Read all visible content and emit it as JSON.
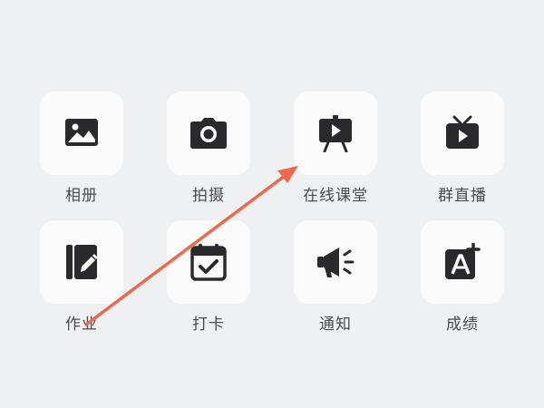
{
  "apps": [
    {
      "label": "相册",
      "icon": "photo-album-icon"
    },
    {
      "label": "拍摄",
      "icon": "camera-icon"
    },
    {
      "label": "在线课堂",
      "icon": "online-class-icon"
    },
    {
      "label": "群直播",
      "icon": "tv-live-icon"
    },
    {
      "label": "作业",
      "icon": "homework-icon"
    },
    {
      "label": "打卡",
      "icon": "check-in-calendar-icon"
    },
    {
      "label": "通知",
      "icon": "megaphone-icon"
    },
    {
      "label": "成绩",
      "icon": "grade-icon"
    }
  ],
  "colors": {
    "background": "#eff0f2",
    "tile": "#fafafb",
    "icon": "#2a2a2c",
    "label": "#4b4b4d",
    "annotation_arrow": "#ec6a4a"
  },
  "annotation": {
    "type": "arrow",
    "from_item": "作业",
    "to_item": "在线课堂"
  }
}
